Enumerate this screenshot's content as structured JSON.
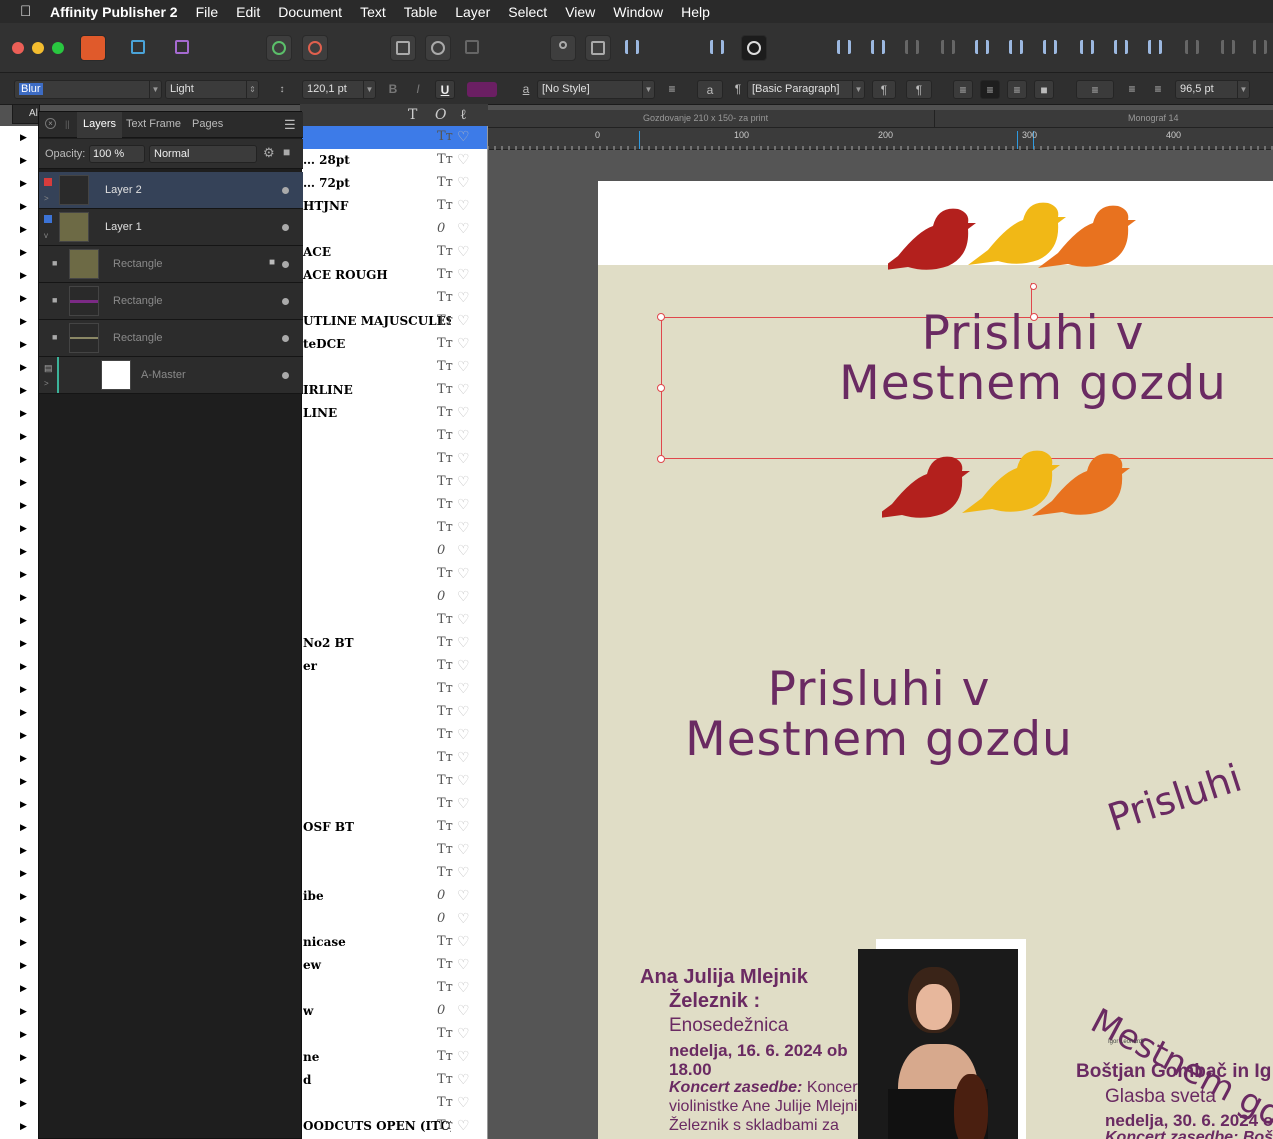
{
  "menubar": {
    "app_name": "Affinity Publisher 2",
    "items": [
      "File",
      "Edit",
      "Document",
      "Text",
      "Table",
      "Layer",
      "Select",
      "View",
      "Window",
      "Help"
    ]
  },
  "context_toolbar": {
    "font_family": "Blur",
    "font_style": "Light",
    "font_size": "120,1 pt",
    "character_style": "[No Style]",
    "paragraph_style": "[Basic Paragraph]",
    "leading": "96,5 pt",
    "text_color": "#6b1f63"
  },
  "document_tabs": {
    "active": "Gozdovanje 210 x 150- za print",
    "other": "Monograf 14"
  },
  "ruler": {
    "labels": [
      "0",
      "100",
      "200",
      "300",
      "400"
    ]
  },
  "layers_panel": {
    "tabs": [
      "Layers",
      "Text Frame",
      "Pages"
    ],
    "opacity_label": "Opacity:",
    "opacity_value": "100 %",
    "blend_mode": "Normal",
    "rows": [
      {
        "name": "Layer 2",
        "selected": true
      },
      {
        "name": "Layer 1",
        "selected": false
      },
      {
        "name": "Rectangle",
        "locked": true
      },
      {
        "name": "Rectangle"
      },
      {
        "name": "Rectangle"
      },
      {
        "name": "A-Master"
      }
    ],
    "side_tab_label": "Al"
  },
  "font_list": {
    "names": [
      "",
      "… 28pt",
      "… 72pt",
      "HTJNF",
      "",
      "ACE",
      "ACE ROUGH",
      "",
      "UTLINE MAJUSCULES",
      "teDCE",
      "",
      "IRLINE",
      "LINE",
      "",
      "",
      "",
      "",
      "",
      "",
      "",
      "",
      "",
      "No2 BT",
      "er",
      "",
      "",
      "",
      "",
      "",
      "",
      "OSF BT",
      "",
      "",
      "ibe",
      "",
      "nicase",
      "ew",
      "",
      "w",
      "",
      "ne",
      "d",
      "",
      "OODCUTS OPEN (ITC)",
      "ce",
      ""
    ],
    "icon_types": [
      "T",
      "T",
      "T",
      "T",
      "O",
      "T",
      "T",
      "T",
      "T",
      "T",
      "T",
      "T",
      "T",
      "T",
      "T",
      "T",
      "T",
      "T",
      "O",
      "T",
      "O",
      "T",
      "T",
      "T",
      "T",
      "T",
      "T",
      "T",
      "T",
      "T",
      "T",
      "T",
      "T",
      "O",
      "O",
      "T",
      "T",
      "T",
      "O",
      "T",
      "T",
      "T",
      "T",
      "T",
      "T",
      "O"
    ]
  },
  "page": {
    "title_line1": "Prisluhi v",
    "title_line2": "Mestnem gozdu",
    "curved_text_1": "Prisluhi",
    "curved_text_2": "Mestnem go",
    "small_credit": "Igor Leonardi",
    "event1": {
      "name_line1": "Ana Julija Mlejnik",
      "name_line2": "Železnik :",
      "subtitle": "Enosedežnica",
      "date": "nedelja, 16. 6. 2024 ob",
      "time": "18.00",
      "desc_label": "Koncert zasedbe:",
      "desc1": " Koncert",
      "desc2": "violinistke Ane Julije Mlejnik",
      "desc3": "Železnik s skladbami za"
    },
    "event2": {
      "name": "Boštjan Gombač in Ig",
      "subtitle": "Glasba sveta",
      "date": "nedelja, 30. 6. 2024 ob",
      "desc": "Koncert zasedbe: Bošt"
    },
    "colors": {
      "purple": "#6a2a62",
      "bird_red": "#b3201d",
      "bird_yellow": "#f1b816",
      "bird_orange": "#e8721f",
      "page_bg": "#e0ddc6"
    }
  }
}
